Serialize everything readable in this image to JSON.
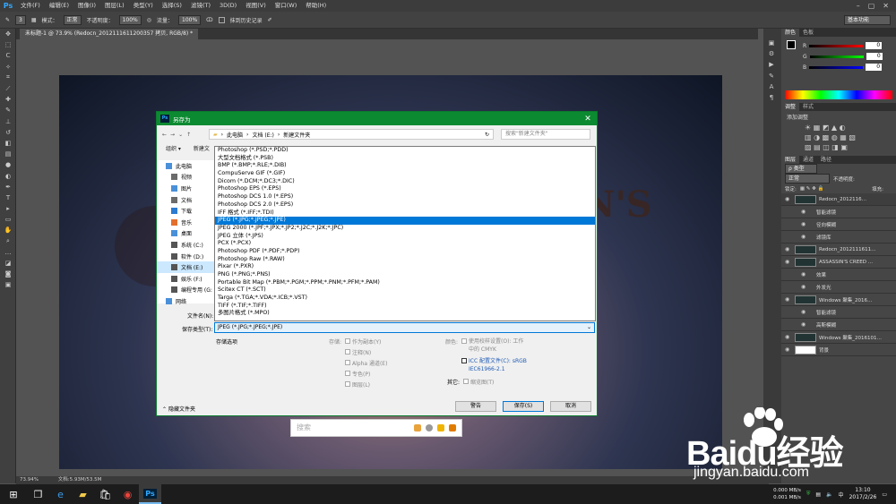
{
  "app": {
    "logo": "Ps",
    "menus": [
      "文件(F)",
      "编辑(E)",
      "图像(I)",
      "图层(L)",
      "类型(Y)",
      "选择(S)",
      "滤镜(T)",
      "3D(D)",
      "视图(V)",
      "窗口(W)",
      "帮助(H)"
    ]
  },
  "options": {
    "size": "3",
    "mode_label": "模式：",
    "mode_value": "正常",
    "opacity_label": "不透明度：",
    "opacity_value": "100%",
    "flow_label": "流量：",
    "flow_value": "100%",
    "history_label": "抹到历史记录",
    "workspace": "基本功能"
  },
  "document": {
    "tab": "未标题-1 @ 73.9% (Redocn_2012111611200357 拷贝, RGB/8) *",
    "title_text": "N'S"
  },
  "status": {
    "zoom": "73.94%",
    "docsize": "文档:5.93M/53.5M"
  },
  "panels": {
    "color_tabs": [
      "颜色",
      "色板"
    ],
    "rgb": [
      {
        "ch": "R",
        "val": "0"
      },
      {
        "ch": "G",
        "val": "0"
      },
      {
        "ch": "B",
        "val": "0"
      }
    ],
    "adjust_tabs": [
      "调整",
      "样式"
    ],
    "adjust_title": "添加调整",
    "layer_tabs": [
      "图层",
      "通道",
      "路径"
    ],
    "filter_kind": "ρ 类型",
    "blend": "正常",
    "opacity_label": "不透明度:",
    "lock_label": "锁定:",
    "fill_label": "填充:",
    "layers": [
      {
        "name": "Redocn_2012116…",
        "kind": "layer",
        "sel": true
      },
      {
        "name": "智能滤镜",
        "kind": "sub"
      },
      {
        "name": "径向模糊",
        "kind": "sub"
      },
      {
        "name": "滤镜库",
        "kind": "sub"
      },
      {
        "name": "Redocn_2012111611…",
        "kind": "layer"
      },
      {
        "name": "ASSASSIN'S CREED …",
        "kind": "layer"
      },
      {
        "name": "效果",
        "kind": "sub"
      },
      {
        "name": "外发光",
        "kind": "sub"
      },
      {
        "name": "Windows 聚集_2016…",
        "kind": "layer"
      },
      {
        "name": "智能滤镜",
        "kind": "sub"
      },
      {
        "name": "高斯模糊",
        "kind": "sub"
      },
      {
        "name": "Windows 聚集_2016101…",
        "kind": "layer"
      },
      {
        "name": "背景",
        "kind": "layer",
        "white": true
      }
    ]
  },
  "dialog": {
    "title": "另存为",
    "path": [
      "此电脑",
      "文档 (E:)",
      "新建文件夹"
    ],
    "search_placeholder": "搜索\"新建文件夹\"",
    "organize": "组织 ▾",
    "new_folder": "新建文",
    "nav": [
      {
        "label": "此电脑",
        "top": true
      },
      {
        "label": "视频"
      },
      {
        "label": "图片"
      },
      {
        "label": "文档"
      },
      {
        "label": "下载"
      },
      {
        "label": "音乐"
      },
      {
        "label": "桌面"
      },
      {
        "label": "系统 (C:)"
      },
      {
        "label": "软件 (D:)"
      },
      {
        "label": "文档 (E:)",
        "sel": true
      },
      {
        "label": "娱乐 (F:)"
      },
      {
        "label": "编程专用 (G:"
      },
      {
        "label": "网络",
        "top": true
      }
    ],
    "filename_label": "文件名(N):",
    "filetype_label": "保存类型(T):",
    "filetype_value": "JPEG (*.JPG;*.JPEG;*.JPE)",
    "types": [
      "Photoshop (*.PSD;*.PDD)",
      "大型文档格式 (*.PSB)",
      "BMP (*.BMP;*.RLE;*.DIB)",
      "CompuServe GIF (*.GIF)",
      "Dicom (*.DCM;*.DC3;*.DIC)",
      "Photoshop EPS (*.EPS)",
      "Photoshop DCS 1.0 (*.EPS)",
      "Photoshop DCS 2.0 (*.EPS)",
      "IFF 格式 (*.IFF;*.TDI)",
      "JPEG (*.JPG;*.JPEG;*.JPE)",
      "JPEG 2000 (*.JPF;*.JPX;*.JP2;*.J2C;*.J2K;*.JPC)",
      "JPEG 立体 (*.JPS)",
      "PCX (*.PCX)",
      "Photoshop PDF (*.PDF;*.PDP)",
      "Photoshop Raw (*.RAW)",
      "Pixar (*.PXR)",
      "PNG (*.PNG;*.PNS)",
      "Portable Bit Map (*.PBM;*.PGM;*.PPM;*.PNM;*.PFM;*.PAM)",
      "Scitex CT (*.SCT)",
      "Targa (*.TGA;*.VDA;*.ICB;*.VST)",
      "TIFF (*.TIF;*.TIFF)",
      "多图片格式 (*.MPO)"
    ],
    "selected_type": 9,
    "save_options": "存储选项",
    "store_label": "存储:",
    "as_copy": "作为副本(Y)",
    "notes": "注释(N)",
    "alpha": "Alpha 通道(E)",
    "spot": "专色(P)",
    "layers": "图层(L)",
    "color_label": "颜色:",
    "proof": "使用校样设置(O): 工作中的 CMYK",
    "icc": "ICC 配置文件(C): sRGB IEC61966-2.1",
    "other_label": "其它:",
    "thumb": "缩览图(T)",
    "hide_folders": "隐藏文件夹",
    "warn_btn": "警告",
    "save_btn": "保存(S)",
    "cancel_btn": "取消"
  },
  "findbar": {
    "placeholder": "搜索"
  },
  "watermark": {
    "main": "Baidu经验",
    "sub": "jingyan.baidu.com"
  },
  "taskbar": {
    "time": "13:10",
    "date": "2017/2/26",
    "net_up": "0.000 MB/s",
    "net_down": "0.001 MB/s",
    "ps": "Ps"
  }
}
